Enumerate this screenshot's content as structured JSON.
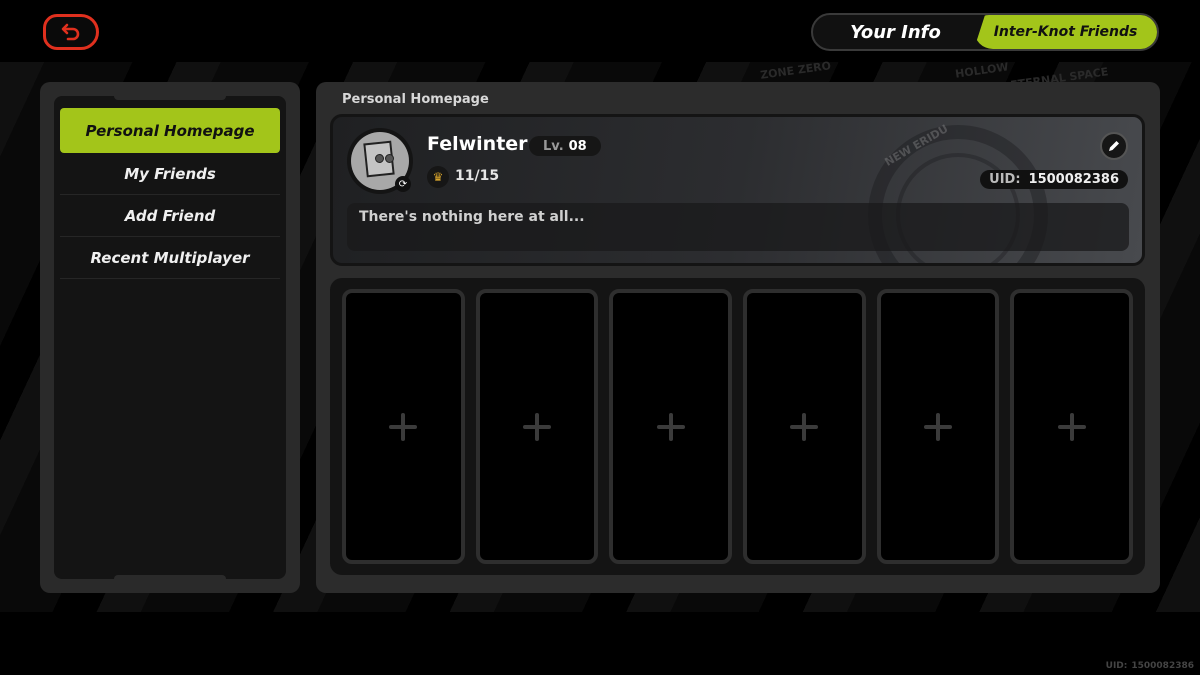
{
  "header": {
    "back_icon": "return-arrow-icon",
    "tabs": [
      {
        "label": "Your Info",
        "active": false
      },
      {
        "label": "Inter-Knot Friends",
        "active": true
      }
    ]
  },
  "sidebar": {
    "items": [
      {
        "label": "Personal Homepage",
        "active": true
      },
      {
        "label": "My Friends",
        "active": false
      },
      {
        "label": "Add Friend",
        "active": false
      },
      {
        "label": "Recent Multiplayer",
        "active": false
      }
    ]
  },
  "main": {
    "title": "Personal Homepage",
    "profile": {
      "username": "Felwinter",
      "level_label": "Lv.",
      "level_value": "08",
      "achievement_icon": "trophy-cake-icon",
      "achievement_count": "11/15",
      "uid_label": "UID:",
      "uid_value": "1500082386",
      "bio": "There's nothing here at all...",
      "emblem_text": "NEW ERIDU"
    },
    "slots": [
      {
        "icon": "plus-icon"
      },
      {
        "icon": "plus-icon"
      },
      {
        "icon": "plus-icon"
      },
      {
        "icon": "plus-icon"
      },
      {
        "icon": "plus-icon"
      },
      {
        "icon": "plus-icon"
      }
    ]
  },
  "background": {
    "texts": [
      "ZONE ZERO",
      "HOLLOW",
      "ETERNAL SPACE"
    ]
  },
  "footer": {
    "uid_label": "UID:",
    "uid_value": "1500082386"
  },
  "colors": {
    "accent": "#a3c51a",
    "back_button": "#e0301e",
    "trophy": "#d6a32c"
  }
}
